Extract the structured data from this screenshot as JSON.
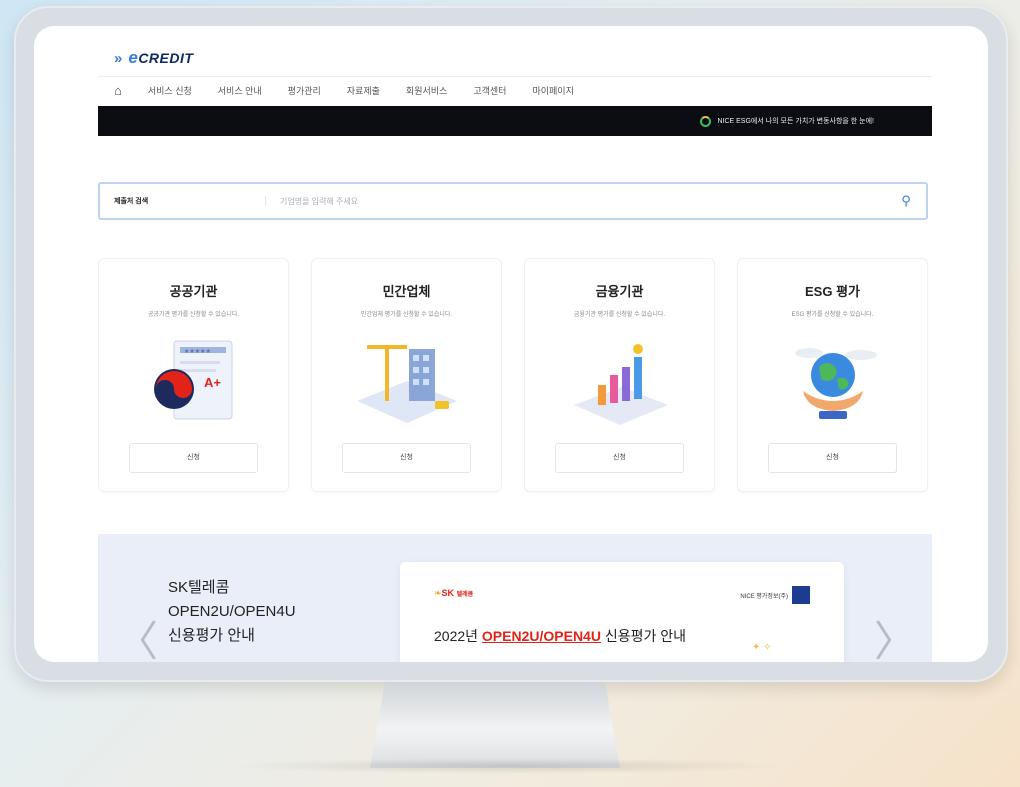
{
  "header": {
    "logo_text": "CREDIT",
    "logo_e": "e",
    "nav": [
      "서비스 신청",
      "서비스 안내",
      "평가관리",
      "자료제출",
      "회원서비스",
      "고객센터",
      "마이페이지"
    ]
  },
  "banner": {
    "text": "NICE ESG에서 나의 모든 가치가 변동사항을 한 눈에!"
  },
  "search": {
    "label": "제출처 검색",
    "placeholder": "기업명을 입력해 주세요"
  },
  "cards": [
    {
      "title": "공공기관",
      "desc": "공공기관 평가를 신청할 수 있습니다.",
      "button": "신청"
    },
    {
      "title": "민간업체",
      "desc": "민간업체 평가를 신청할 수 있습니다.",
      "button": "신청"
    },
    {
      "title": "금융기관",
      "desc": "금융기관 평가를 신청할 수 있습니다.",
      "button": "신청"
    },
    {
      "title": "ESG 평가",
      "desc": "ESG 평가를 신청할 수 있습니다.",
      "button": "신청"
    }
  ],
  "promo": {
    "headline": [
      "SK텔레콤",
      "OPEN2U/OPEN4U",
      "신용평가 안내"
    ],
    "sk_logo": "SK",
    "sk_sub": "텔레콤",
    "nice_logo": "NICE 평가정보(주)",
    "big_prefix": "2022년 ",
    "big_highlight": "OPEN2U/OPEN4U",
    "big_suffix": " 신용평가 안내"
  },
  "colors": {
    "accent": "#3a7bd5",
    "brand_red": "#e2231a",
    "banner_bg": "#0b0d12"
  }
}
